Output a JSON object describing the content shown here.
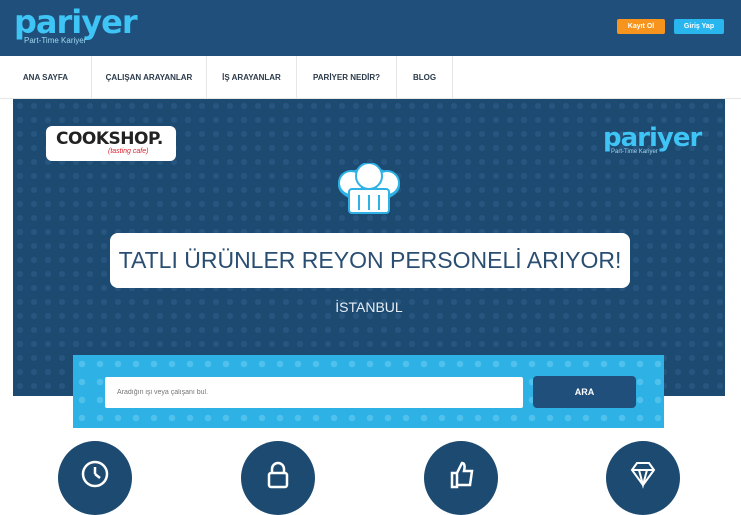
{
  "brand": {
    "logo": "pariyer",
    "tagline": "Part-Time Kariyer"
  },
  "header": {
    "register_label": "Kayıt Ol",
    "login_label": "Giriş Yap"
  },
  "nav": {
    "items": [
      "ANA SAYFA",
      "ÇALIŞAN ARAYANLAR",
      "İŞ ARAYANLAR",
      "PARİYER NEDİR?",
      "BLOG"
    ]
  },
  "hero": {
    "company_logo": {
      "word": "COOKSHOP.",
      "sub": "(tasting cafe)"
    },
    "headline": "TATLI ÜRÜNLER REYON PERSONELİ ARIYOR!",
    "city": "İSTANBUL"
  },
  "search": {
    "placeholder": "Aradığın işi veya çalışanı bul.",
    "button_label": "ARA"
  },
  "features": {
    "icons": [
      "clock-icon",
      "lock-icon",
      "thumbs-up-icon",
      "diamond-icon"
    ]
  },
  "colors": {
    "header_bg": "#1f4f7a",
    "accent_blue": "#29b6ef",
    "accent_orange": "#f7941d",
    "hero_bg": "#1d4a70"
  }
}
